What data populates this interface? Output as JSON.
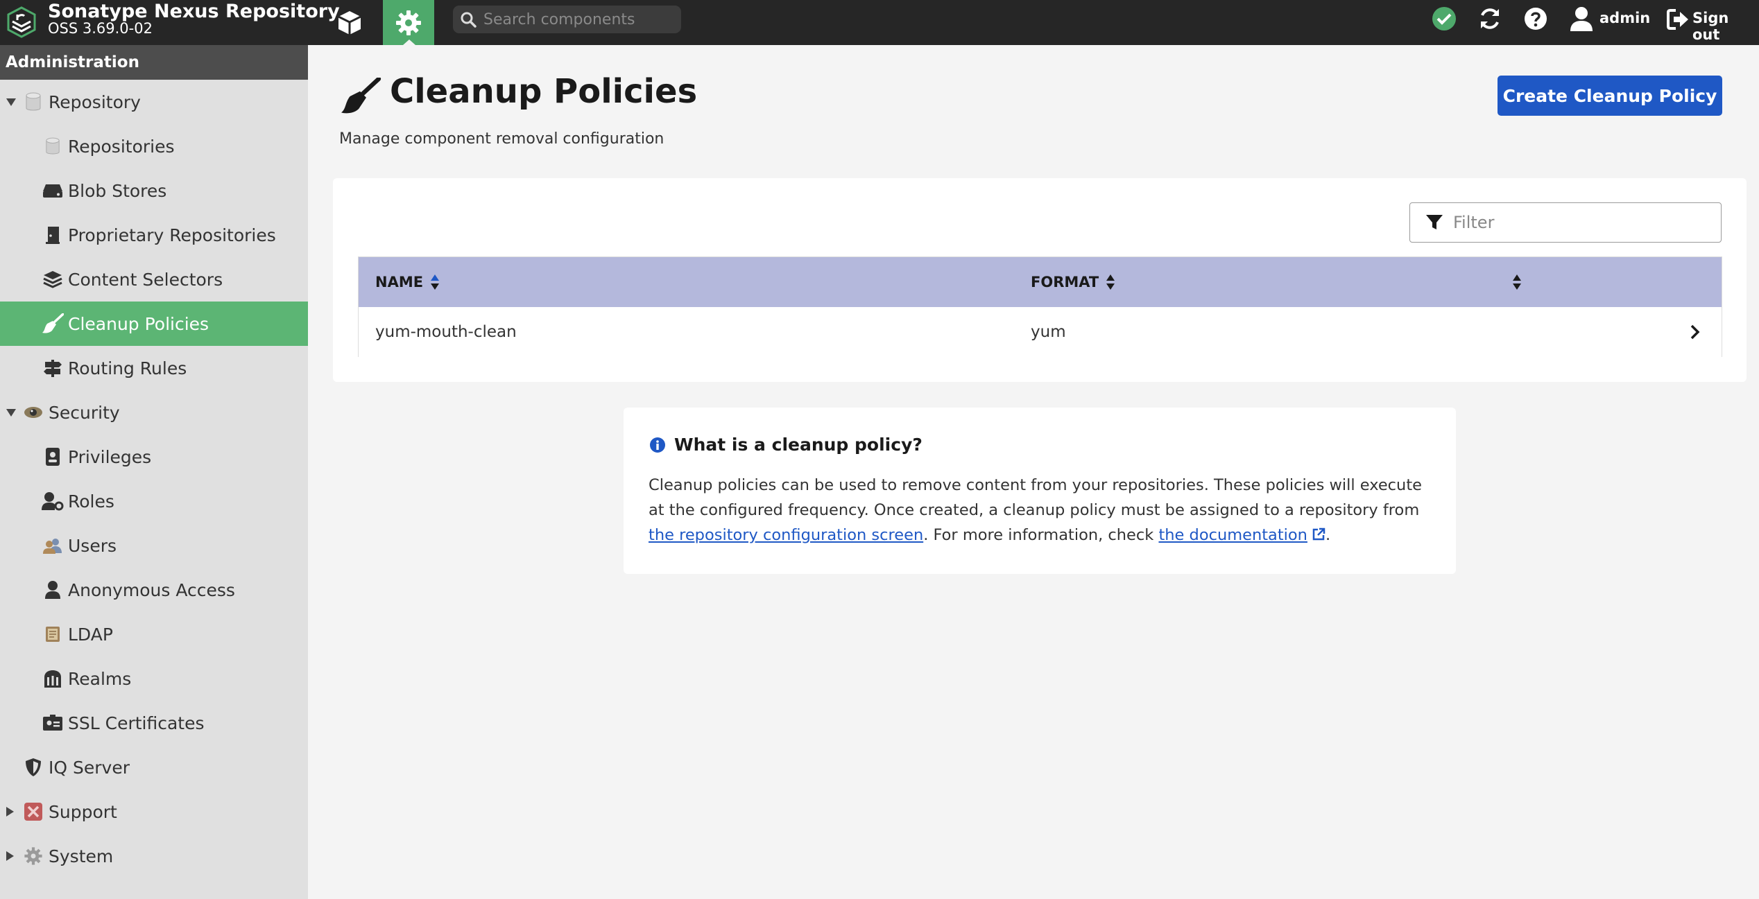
{
  "header": {
    "product": "Sonatype Nexus Repository",
    "version": "OSS 3.69.0-02",
    "search_placeholder": "Search components",
    "user": "admin",
    "signout": "Sign out"
  },
  "sidebar": {
    "title": "Administration",
    "items": [
      {
        "label": "Repository",
        "icon": "database-icon",
        "expanded": true
      },
      {
        "label": "Repositories",
        "icon": "database-icon"
      },
      {
        "label": "Blob Stores",
        "icon": "hard-drive-icon"
      },
      {
        "label": "Proprietary Repositories",
        "icon": "door-icon"
      },
      {
        "label": "Content Selectors",
        "icon": "layers-icon"
      },
      {
        "label": "Cleanup Policies",
        "icon": "broom-icon",
        "active": true
      },
      {
        "label": "Routing Rules",
        "icon": "signpost-icon"
      },
      {
        "label": "Security",
        "icon": "eye-icon",
        "expanded": true
      },
      {
        "label": "Privileges",
        "icon": "id-badge-icon"
      },
      {
        "label": "Roles",
        "icon": "user-gear-icon"
      },
      {
        "label": "Users",
        "icon": "users-icon"
      },
      {
        "label": "Anonymous Access",
        "icon": "user-icon"
      },
      {
        "label": "LDAP",
        "icon": "book-icon"
      },
      {
        "label": "Realms",
        "icon": "realm-icon"
      },
      {
        "label": "SSL Certificates",
        "icon": "certificate-icon"
      },
      {
        "label": "IQ Server",
        "icon": "shield-icon"
      },
      {
        "label": "Support",
        "icon": "support-icon",
        "expanded": false
      },
      {
        "label": "System",
        "icon": "gear-icon",
        "expanded": false
      }
    ]
  },
  "page": {
    "title": "Cleanup Policies",
    "subtitle": "Manage component removal configuration",
    "create_button": "Create Cleanup Policy",
    "filter_placeholder": "Filter"
  },
  "table": {
    "columns": [
      "NAME",
      "FORMAT",
      ""
    ],
    "rows": [
      {
        "name": "yum-mouth-clean",
        "format": "yum"
      }
    ]
  },
  "info": {
    "title": "What is a cleanup policy?",
    "text_1": "Cleanup policies can be used to remove content from your repositories. These policies will execute at the configured frequency. Once created, a cleanup policy must be assigned to a repository from ",
    "link_1": "the repository configuration screen",
    "text_2": ". For more information, check ",
    "link_2": "the documentation",
    "text_3": "."
  },
  "colors": {
    "topbar": "#262626",
    "accent_green": "#5cb574",
    "primary_blue": "#1f58c5",
    "table_header": "#b4b8dc",
    "status_ok": "#4ea96b"
  }
}
